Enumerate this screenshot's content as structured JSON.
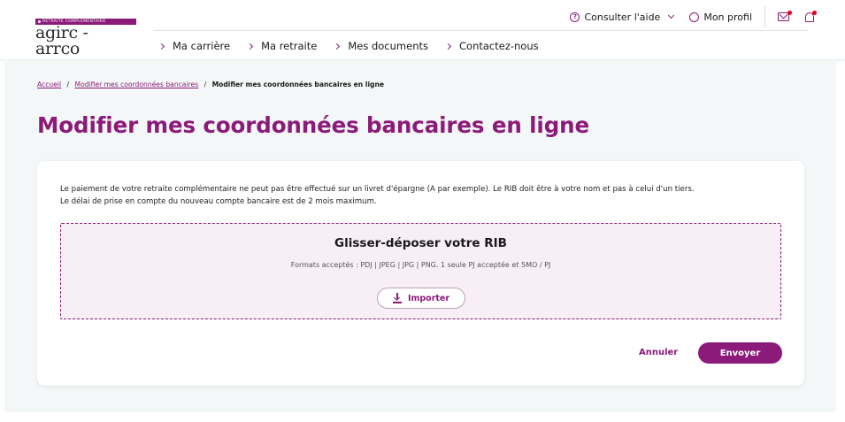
{
  "header": {
    "logo": {
      "banner": "RETRAITE COMPLÉMENTAIRE",
      "name": "agirc - arrco"
    },
    "topbar": {
      "help_label": "Consulter l'aide",
      "profile_label": "Mon profil"
    },
    "nav": [
      {
        "label": "Ma carrière"
      },
      {
        "label": "Ma retraite"
      },
      {
        "label": "Mes documents"
      },
      {
        "label": "Contactez-nous"
      }
    ]
  },
  "breadcrumb": {
    "home": "Accueil",
    "parent": "Modifier mes coordonnées bancaires",
    "current": "Modifier mes coordonnées bancaires en ligne",
    "separator": "/"
  },
  "page_title": "Modifier mes coordonnées bancaires en ligne",
  "form": {
    "intro_line1": "Le paiement de votre retraite complémentaire ne peut pas être effectué sur un livret d'épargne (A par exemple). Le RIB doit être à votre nom et pas à celui d'un tiers.",
    "intro_line2": "Le délai de prise en compte du nouveau compte bancaire est de 2 mois maximum.",
    "dropzone": {
      "title": "Glisser-déposer votre RIB",
      "formats": "Formats acceptés : PDJ | JPEG | JPG | PNG. 1 seule PJ acceptée et 5MO / PJ",
      "import_label": "Importer"
    },
    "cancel_label": "Annuler",
    "submit_label": "Envoyer"
  },
  "colors": {
    "brand": "#8b1a7a",
    "notification": "#e2001a",
    "background": "#f3f7f7",
    "dropzone_bg": "#f8eef5"
  },
  "icons": [
    "help-icon",
    "chevron-down-icon",
    "user-icon",
    "mail-icon",
    "bell-icon",
    "chevron-right-icon",
    "download-icon"
  ]
}
